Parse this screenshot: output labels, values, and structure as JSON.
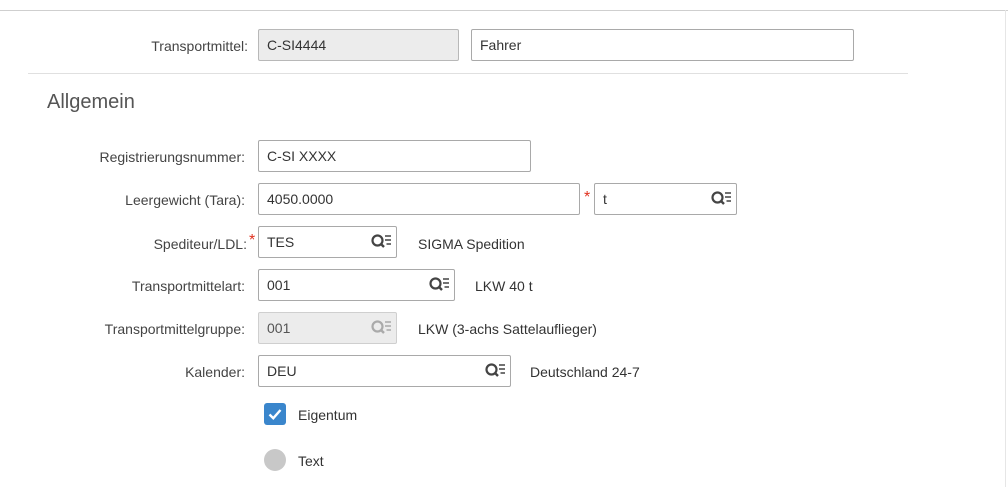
{
  "header": {
    "transport_label": "Transportmittel:",
    "transport_value": "C-SI4444",
    "driver_value": "Fahrer"
  },
  "section": {
    "title": "Allgemein"
  },
  "fields": {
    "registration": {
      "label": "Registrierungsnummer:",
      "value": "C-SI XXXX"
    },
    "tare": {
      "label": "Leergewicht (Tara):",
      "value": "4050.0000",
      "unit": "t",
      "unit_required": true
    },
    "carrier": {
      "label": "Spediteur/LDL:",
      "required": true,
      "value": "TES",
      "description": "SIGMA Spedition"
    },
    "vehicle_type": {
      "label": "Transportmittelart:",
      "value": "001",
      "description": "LKW 40 t"
    },
    "vehicle_group": {
      "label": "Transportmittelgruppe:",
      "value": "001",
      "description": "LKW (3-achs Sattelauflieger)",
      "disabled": true
    },
    "calendar": {
      "label": "Kalender:",
      "value": "DEU",
      "description": "Deutschland 24-7"
    }
  },
  "options": {
    "ownership": {
      "label": "Eigentum",
      "checked": true
    },
    "text": {
      "label": "Text",
      "selected": false
    }
  },
  "colors": {
    "required": "#e0301e",
    "checkbox": "#3a86cc",
    "value_help_icon": "#444444"
  },
  "icons": {
    "value_help": "value-help-icon",
    "checkmark": "checkmark-icon"
  }
}
